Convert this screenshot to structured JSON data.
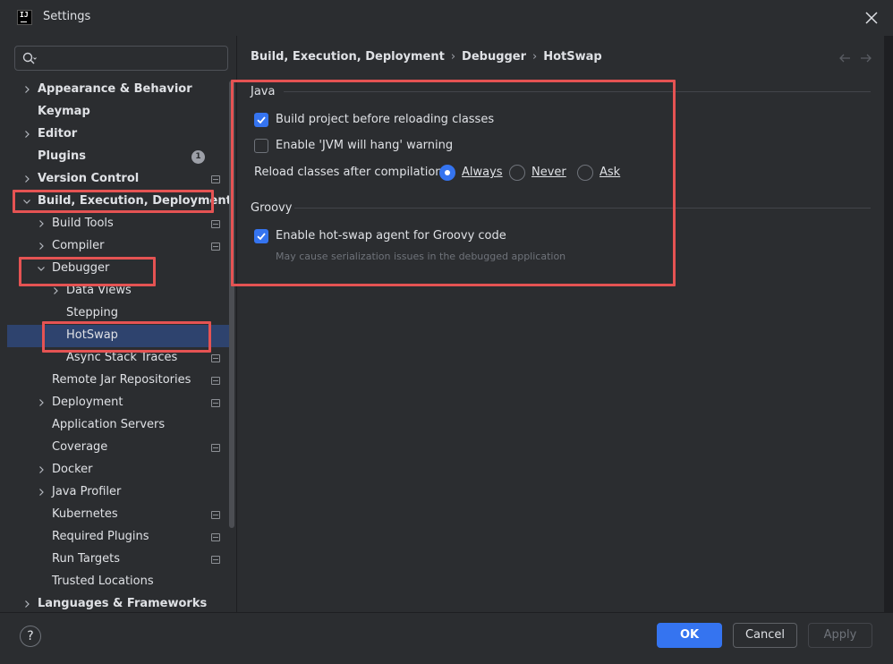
{
  "window": {
    "title": "Settings",
    "app_logo_text": "IJ"
  },
  "search": {
    "placeholder": ""
  },
  "tree": [
    {
      "label": "Appearance & Behavior",
      "level": 0,
      "expandable": true,
      "expanded": false,
      "bold": true
    },
    {
      "label": "Keymap",
      "level": 0,
      "expandable": false,
      "bold": true
    },
    {
      "label": "Editor",
      "level": 0,
      "expandable": true,
      "expanded": false,
      "bold": true
    },
    {
      "label": "Plugins",
      "level": 0,
      "expandable": false,
      "bold": true,
      "badge": "1"
    },
    {
      "label": "Version Control",
      "level": 0,
      "expandable": true,
      "expanded": false,
      "bold": true,
      "scope": true
    },
    {
      "label": "Build, Execution, Deployment",
      "level": 0,
      "expandable": true,
      "expanded": true,
      "bold": true
    },
    {
      "label": "Build Tools",
      "level": 1,
      "expandable": true,
      "expanded": false,
      "scope": true
    },
    {
      "label": "Compiler",
      "level": 1,
      "expandable": true,
      "expanded": false,
      "scope": true
    },
    {
      "label": "Debugger",
      "level": 1,
      "expandable": true,
      "expanded": true
    },
    {
      "label": "Data Views",
      "level": 2,
      "expandable": true,
      "expanded": false
    },
    {
      "label": "Stepping",
      "level": 2,
      "expandable": false
    },
    {
      "label": "HotSwap",
      "level": 2,
      "expandable": false,
      "selected": true
    },
    {
      "label": "Async Stack Traces",
      "level": 2,
      "expandable": false,
      "scope": true
    },
    {
      "label": "Remote Jar Repositories",
      "level": 1,
      "expandable": false,
      "scope": true
    },
    {
      "label": "Deployment",
      "level": 1,
      "expandable": true,
      "expanded": false,
      "scope": true
    },
    {
      "label": "Application Servers",
      "level": 1,
      "expandable": false
    },
    {
      "label": "Coverage",
      "level": 1,
      "expandable": false,
      "scope": true
    },
    {
      "label": "Docker",
      "level": 1,
      "expandable": true,
      "expanded": false
    },
    {
      "label": "Java Profiler",
      "level": 1,
      "expandable": true,
      "expanded": false
    },
    {
      "label": "Kubernetes",
      "level": 1,
      "expandable": false,
      "scope": true
    },
    {
      "label": "Required Plugins",
      "level": 1,
      "expandable": false,
      "scope": true
    },
    {
      "label": "Run Targets",
      "level": 1,
      "expandable": false,
      "scope": true
    },
    {
      "label": "Trusted Locations",
      "level": 1,
      "expandable": false
    },
    {
      "label": "Languages & Frameworks",
      "level": 0,
      "expandable": true,
      "expanded": false,
      "bold": true
    }
  ],
  "breadcrumb": {
    "items": [
      "Build, Execution, Deployment",
      "Debugger",
      "HotSwap"
    ]
  },
  "java": {
    "title": "Java",
    "build_before_reload": {
      "label": "Build project before reloading classes",
      "checked": true
    },
    "jvm_hang_warning": {
      "label": "Enable 'JVM will hang' warning",
      "checked": false
    },
    "reload_label": "Reload classes after compilation:",
    "reload_options": [
      {
        "label": "Always",
        "selected": true
      },
      {
        "label": "Never",
        "selected": false
      },
      {
        "label": "Ask",
        "selected": false
      }
    ]
  },
  "groovy": {
    "title": "Groovy",
    "hotswap_agent": {
      "label": "Enable hot-swap agent for Groovy code",
      "checked": true
    },
    "hint": "May cause serialization issues in the debugged application"
  },
  "buttons": {
    "help": "?",
    "ok": "OK",
    "cancel": "Cancel",
    "apply": "Apply"
  },
  "colors": {
    "accent": "#3574f0",
    "annotation": "#e55353",
    "selection": "#2e436e",
    "background": "#2b2d30"
  }
}
